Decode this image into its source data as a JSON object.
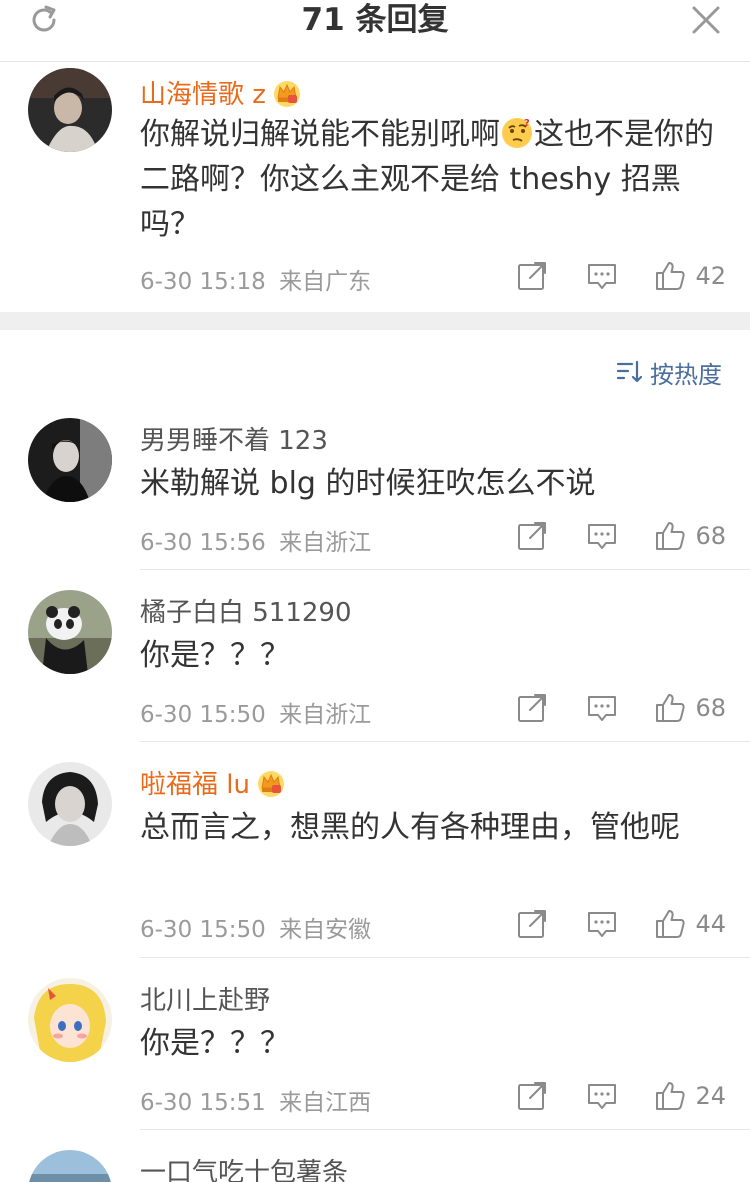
{
  "header": {
    "title": "71 条回复",
    "refresh_icon": "refresh-icon",
    "close_icon": "close-icon"
  },
  "top_comment": {
    "name": "山海情歌 z",
    "vip": true,
    "text_before_emoji": "你解说归解说能不能别吼啊",
    "emoji": "thinking-face",
    "text_after_emoji": "这也不是你的二路啊？你这么主观不是给 theshy 招黑吗？",
    "time": "6-30 15:18",
    "location": "来自广东",
    "likes": "42"
  },
  "sort": {
    "label": "按热度"
  },
  "replies": [
    {
      "name": "男男睡不着 123",
      "vip": false,
      "text": "米勒解说 blg 的时候狂吹怎么不说",
      "time": "6-30 15:56",
      "location": "来自浙江",
      "likes": "68"
    },
    {
      "name": "橘子白白 511290",
      "vip": false,
      "text": "你是？？？",
      "time": "6-30 15:50",
      "location": "来自浙江",
      "likes": "68"
    },
    {
      "name": "啦福福 lu",
      "vip": true,
      "text": "总而言之，想黑的人有各种理由，管他呢",
      "time": "6-30 15:50",
      "location": "来自安徽",
      "likes": "44"
    },
    {
      "name": "北川上赴野",
      "vip": false,
      "text": "你是？？？",
      "time": "6-30 15:51",
      "location": "来自江西",
      "likes": "24"
    },
    {
      "name": "一口气吃十包薯条",
      "vip": false
    }
  ],
  "colors": {
    "vip_name": "#e86b1c",
    "accent_link": "#4a6f9c",
    "meta": "#9a9a9a",
    "separator": "#efefef"
  }
}
